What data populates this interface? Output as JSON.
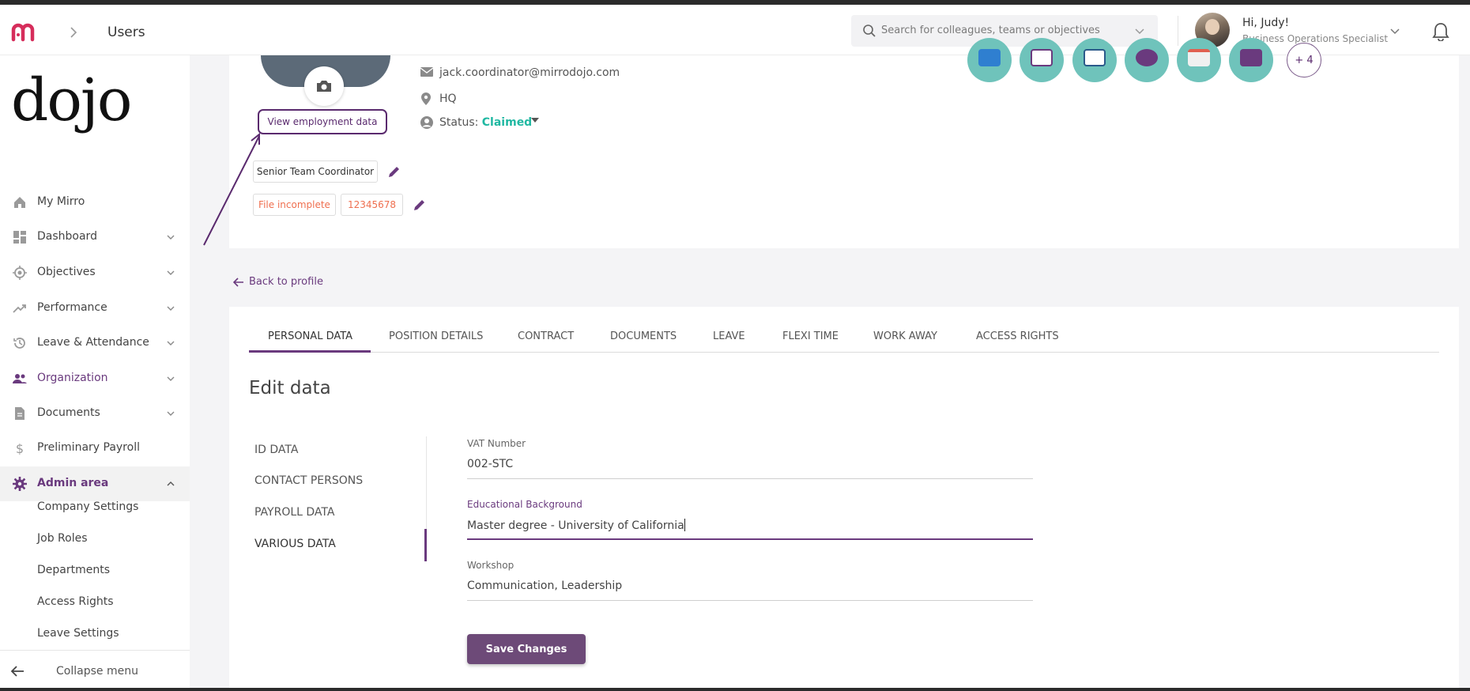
{
  "header": {
    "breadcrumb": "Users",
    "search_placeholder": "Search for colleagues, teams or objectives",
    "greeting": "Hi, Judy!",
    "user_role": "Business Operations Specialist"
  },
  "brand": {
    "logo_text": "dojo"
  },
  "sidebar": {
    "items": [
      {
        "label": "My Mirro",
        "icon": "home-icon",
        "has_chevron": false
      },
      {
        "label": "Dashboard",
        "icon": "dashboard-icon",
        "has_chevron": true
      },
      {
        "label": "Objectives",
        "icon": "target-icon",
        "has_chevron": true
      },
      {
        "label": "Performance",
        "icon": "trending-icon",
        "has_chevron": true
      },
      {
        "label": "Leave & Attendance",
        "icon": "history-icon",
        "has_chevron": true
      },
      {
        "label": "Organization",
        "icon": "people-icon",
        "has_chevron": true
      },
      {
        "label": "Documents",
        "icon": "document-icon",
        "has_chevron": true
      },
      {
        "label": "Preliminary Payroll",
        "icon": "dollar-icon",
        "has_chevron": false
      },
      {
        "label": "Admin area",
        "icon": "gear-icon",
        "has_chevron": true
      }
    ],
    "admin_subitems": [
      "Company Settings",
      "Job Roles",
      "Departments",
      "Access Rights",
      "Leave Settings"
    ],
    "collapse_label": "Collapse menu"
  },
  "profile": {
    "view_employment_label": "View employment data",
    "email": "jack.coordinator@mirrodojo.com",
    "location": "HQ",
    "status_label": "Status:",
    "status_value": "Claimed",
    "position": "Senior Team Coordinator",
    "file_status": "File incomplete",
    "file_number": "12345678",
    "badges_more": "+ 4"
  },
  "back_link": "Back to profile",
  "tabs": [
    "PERSONAL DATA",
    "POSITION DETAILS",
    "CONTRACT",
    "DOCUMENTS",
    "LEAVE",
    "FLEXI TIME",
    "WORK AWAY",
    "ACCESS RIGHTS"
  ],
  "edit_heading": "Edit data",
  "subtabs": [
    "ID DATA",
    "CONTACT PERSONS",
    "PAYROLL DATA",
    "VARIOUS DATA"
  ],
  "form": {
    "vat": {
      "label": "VAT Number",
      "value": "002-STC"
    },
    "education": {
      "label": "Educational Background",
      "value": "Master degree - University of California"
    },
    "workshop": {
      "label": "Workshop",
      "value": "Communication, Leadership"
    },
    "save_label": "Save Changes"
  },
  "colors": {
    "accent": "#6a3a7e",
    "status": "#20b8a2",
    "warning": "#ef6f4f",
    "badge": "#6fc3bb"
  }
}
